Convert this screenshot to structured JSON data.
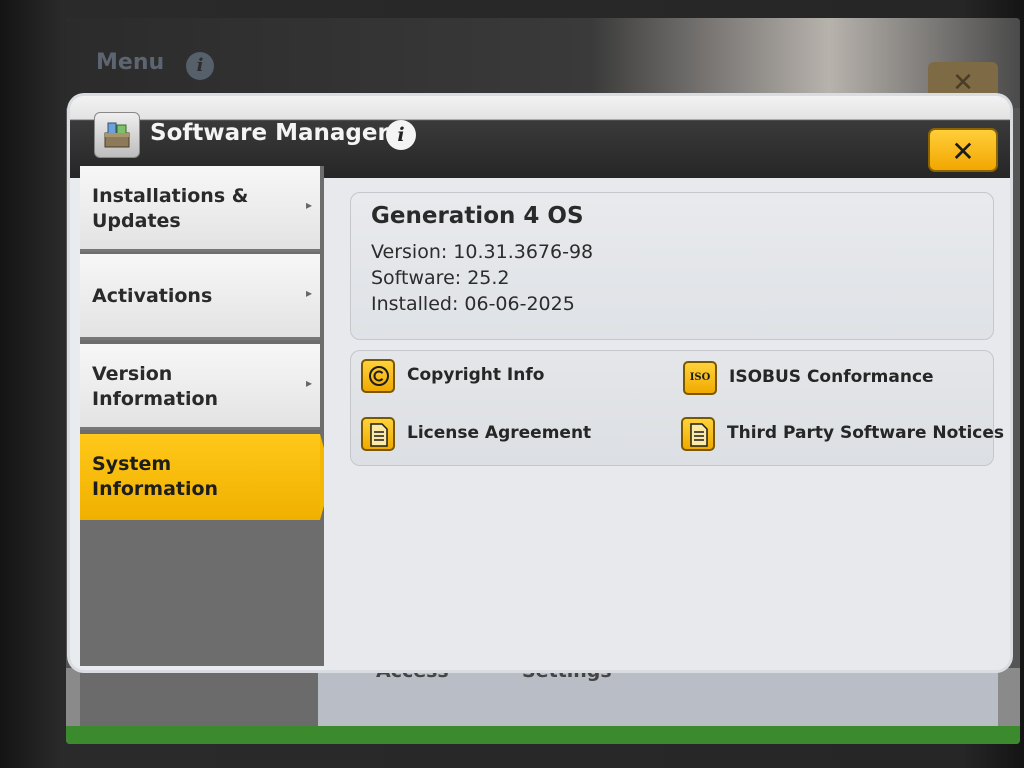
{
  "background_app": {
    "menu_title": "Menu",
    "tiles": [
      "Access",
      "Settings"
    ]
  },
  "dialog": {
    "title": "Software Manager",
    "info_glyph": "i",
    "close_glyph": "✕"
  },
  "nav": {
    "items": [
      {
        "label": "Installations & Updates",
        "arrow": "▸",
        "active": false
      },
      {
        "label": "Activations",
        "arrow": "▸",
        "active": false
      },
      {
        "label": "Version Information",
        "arrow": "▸",
        "active": false
      },
      {
        "label": "System Information",
        "arrow": "",
        "active": true
      }
    ]
  },
  "system_info": {
    "os_name": "Generation 4 OS",
    "version": "Version: 10.31.3676-98",
    "software": "Software: 25.2",
    "installed": "Installed: 06-06-2025"
  },
  "links": {
    "copyright": {
      "label": "Copyright Info",
      "icon": "copyright-icon"
    },
    "isobus": {
      "label": "ISOBUS Conformance",
      "icon": "iso-icon",
      "icon_text": "ISO"
    },
    "license": {
      "label": "License Agreement",
      "icon": "document-icon"
    },
    "third_party": {
      "label": "Third Party Software Notices",
      "icon": "document-icon"
    }
  },
  "colors": {
    "accent": "#f4b800",
    "header": "#262626",
    "panel": "#e7e9ec"
  }
}
